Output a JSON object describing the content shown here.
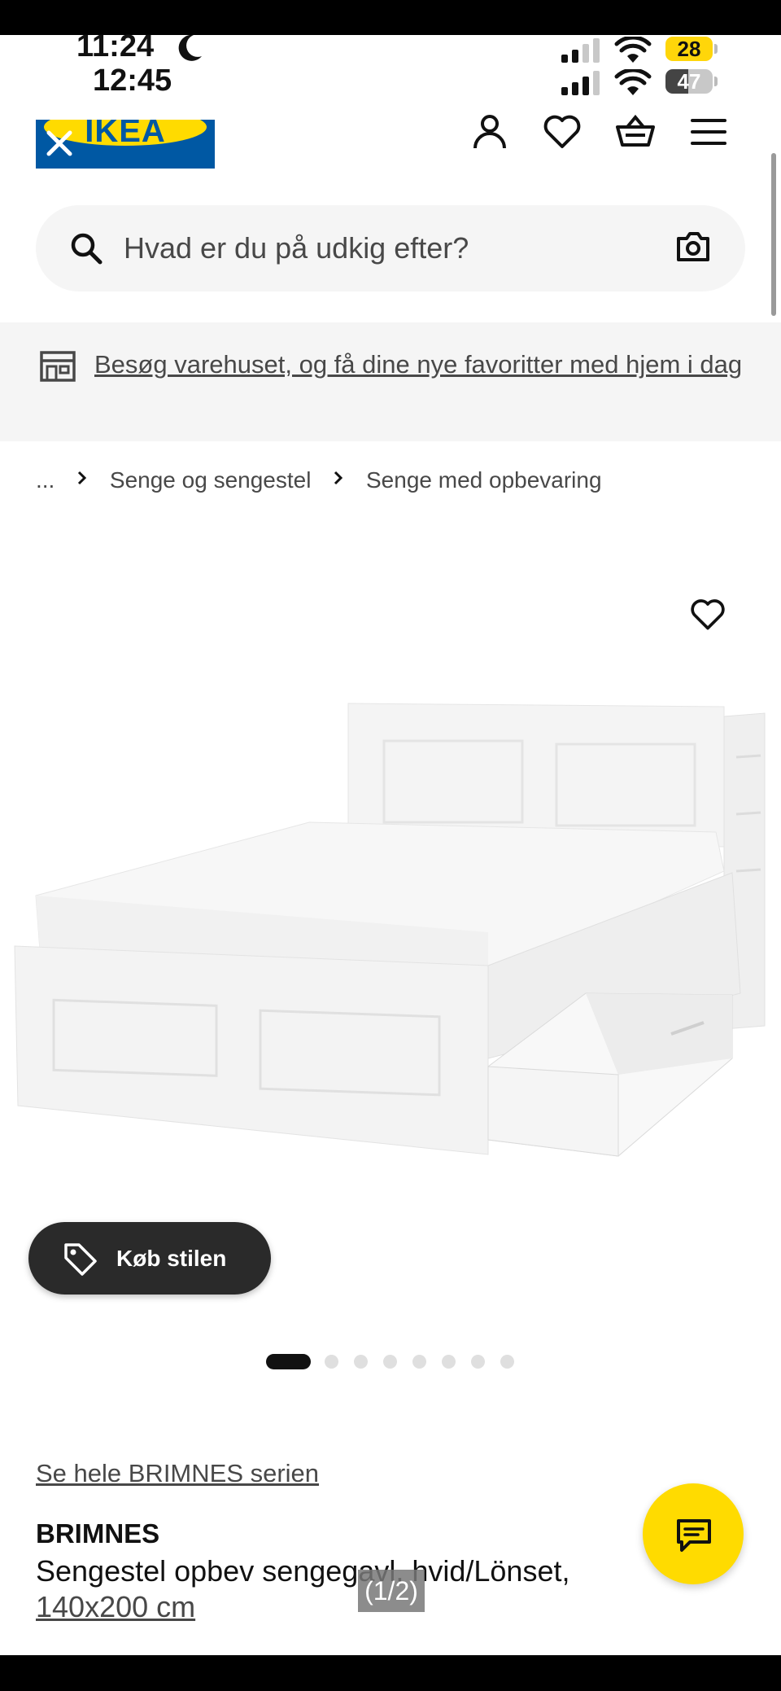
{
  "status_bar": {
    "time_primary": "11:24",
    "time_secondary": "12:45",
    "battery_primary": "28",
    "battery_secondary": "47",
    "battery_primary_color": "#ffd60a",
    "battery_secondary_color": "#555555"
  },
  "header": {
    "logo_text": "IKEA",
    "logo_colors": {
      "blue": "#0058a3",
      "yellow": "#ffdb00"
    },
    "icons": [
      "close-icon",
      "person-icon",
      "heart-icon",
      "basket-icon",
      "menu-icon"
    ]
  },
  "search": {
    "placeholder": "Hvad er du på udkig efter?",
    "icons": [
      "search-icon",
      "camera-icon"
    ]
  },
  "banner": {
    "text": "Besøg varehuset, og få dine nye favoritter med hjem i dag",
    "icon": "store-icon"
  },
  "breadcrumb": {
    "ellipsis": "...",
    "items": [
      "Senge og sengestel",
      "Senge med opbevaring"
    ]
  },
  "product_media": {
    "image": "bed-image",
    "favorite_icon": "heart-icon",
    "buy_style_label": "Køb stilen",
    "buy_style_icon": "tag-icon",
    "dot_count": 8,
    "active_dot": 1
  },
  "product": {
    "series_link": "Se hele BRIMNES serien",
    "name": "BRIMNES",
    "description": "Sengestel opbev sengegavl, hvid/Lönset,",
    "size": "140x200 cm"
  },
  "overlay": {
    "pager": "(1/2)",
    "chat_icon": "chat-icon",
    "accent": "#ffdb00"
  }
}
